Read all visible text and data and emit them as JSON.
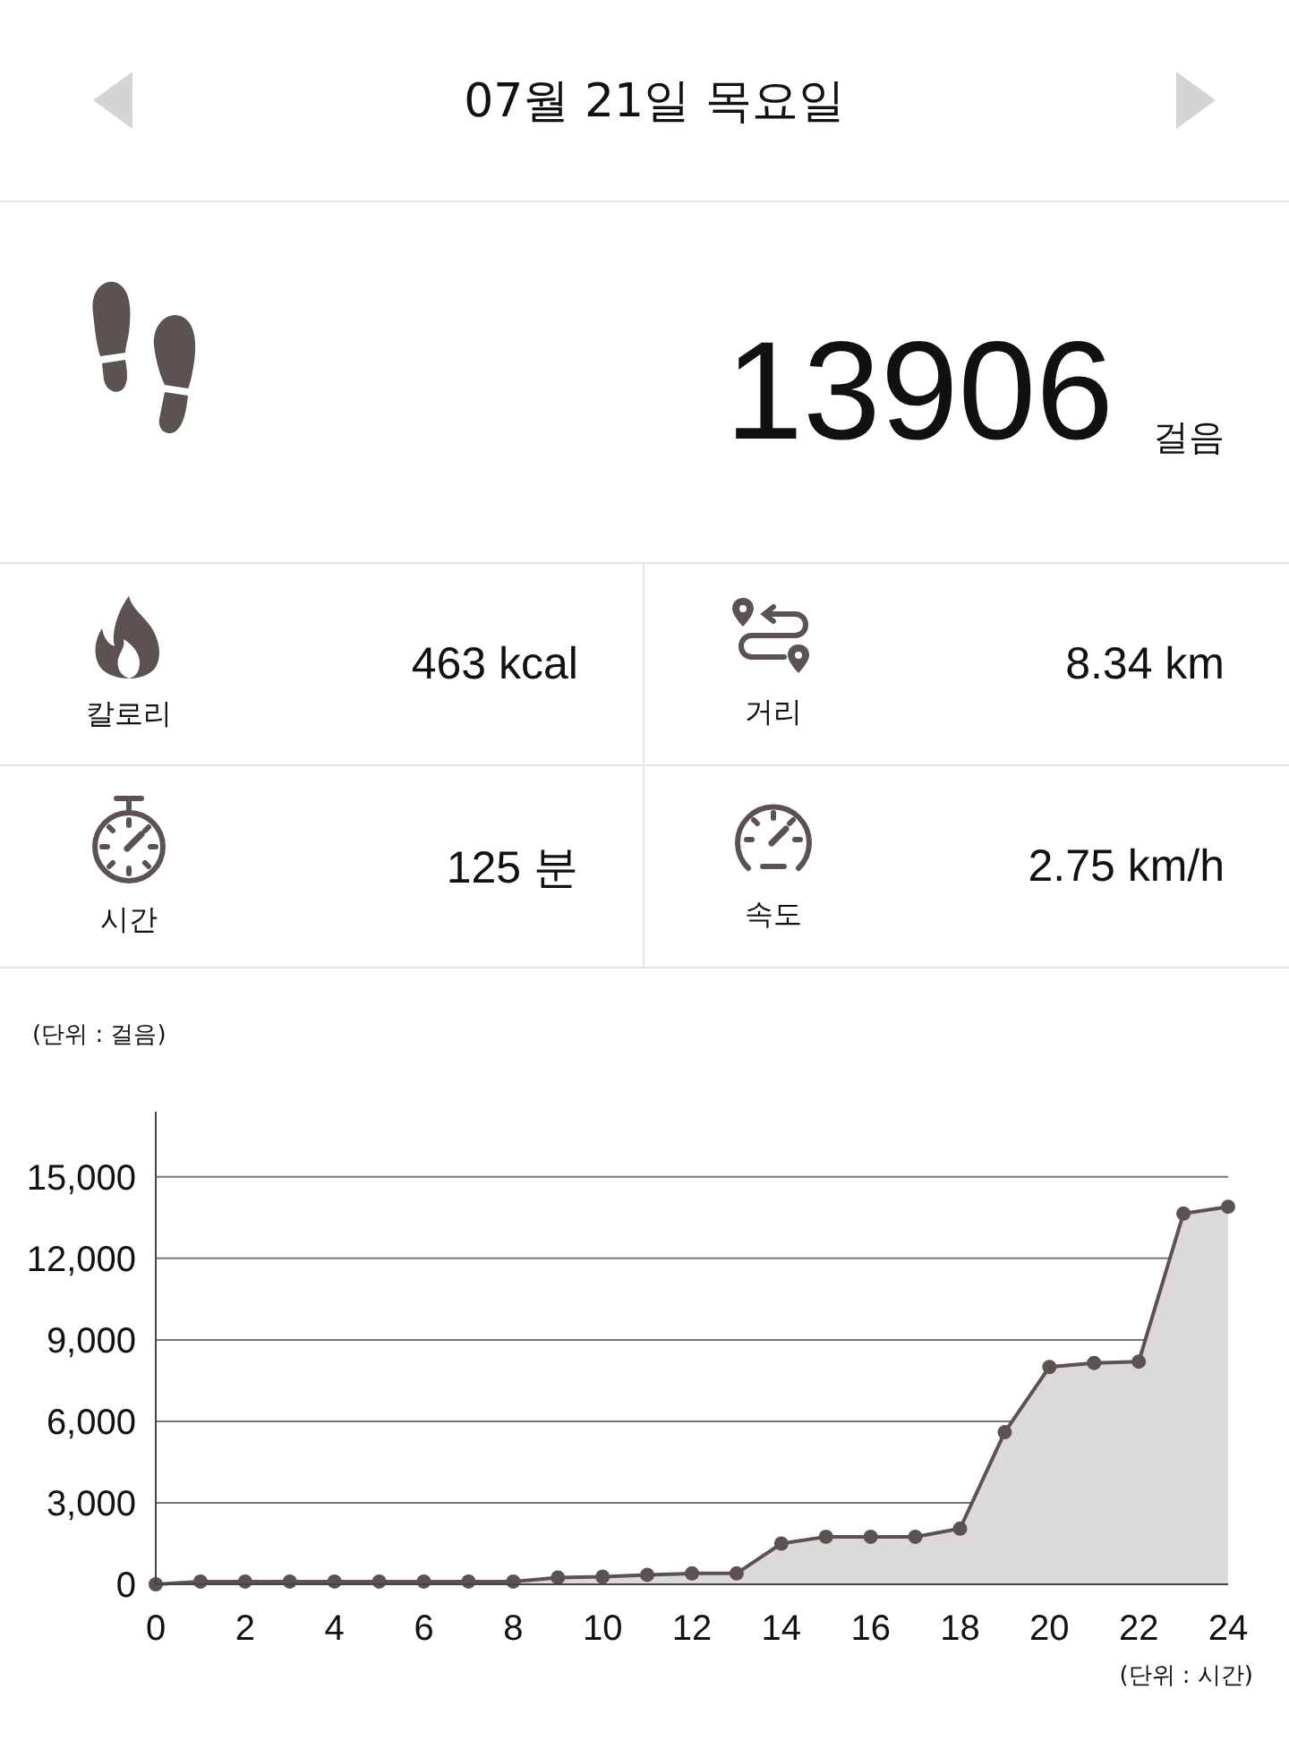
{
  "header": {
    "date": "07월 21일 목요일"
  },
  "steps": {
    "value": "13906",
    "unit": "걸음"
  },
  "stats": [
    {
      "kind": "calories",
      "label": "칼로리",
      "value": "463 kcal"
    },
    {
      "kind": "distance",
      "label": "거리",
      "value": "8.34 km"
    },
    {
      "kind": "time",
      "label": "시간",
      "value": "125 분"
    },
    {
      "kind": "speed",
      "label": "속도",
      "value": "2.75 km/h"
    }
  ],
  "chart": {
    "y_unit": "(단위 : 걸음)",
    "x_unit": "(단위 : 시간)",
    "chart_data": {
      "type": "area",
      "x": [
        0,
        1,
        2,
        3,
        4,
        5,
        6,
        7,
        8,
        9,
        10,
        11,
        12,
        13,
        14,
        15,
        16,
        17,
        18,
        19,
        20,
        21,
        22,
        23,
        24
      ],
      "series": [
        {
          "color": "#5c5252",
          "values": [
            0,
            100,
            100,
            100,
            100,
            100,
            100,
            100,
            100,
            250,
            280,
            350,
            400,
            400,
            1500,
            1750,
            1750,
            1750,
            2050,
            5600,
            8000,
            8150,
            8200,
            13650,
            13900
          ]
        }
      ],
      "grid": true,
      "xlim": [
        0,
        24
      ],
      "ylim": [
        0,
        17400
      ],
      "xticks": [
        0,
        2,
        4,
        6,
        8,
        10,
        12,
        14,
        16,
        18,
        20,
        22,
        24
      ],
      "yticks": [
        {
          "value": 0,
          "label": "0"
        },
        {
          "value": 3000,
          "label": "3,000"
        },
        {
          "value": 6000,
          "label": "6,000"
        },
        {
          "value": 9000,
          "label": "9,000"
        },
        {
          "value": 12000,
          "label": "12,000"
        },
        {
          "value": 15000,
          "label": "15,000"
        }
      ]
    }
  }
}
